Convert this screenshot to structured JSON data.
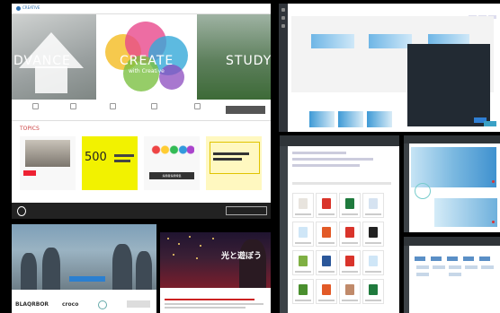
{
  "corporate_site": {
    "hero_words": [
      "DVANCE",
      "CREATE",
      "STUDY"
    ],
    "hero_sub": "with Creative",
    "section_title": "TOPICS",
    "card_number": "500",
    "card_cta": "採用者採用特集"
  },
  "campaign": {
    "headline": "光と遊ぼう"
  },
  "landing_brands": [
    "BLAQRBOR",
    "croco"
  ]
}
